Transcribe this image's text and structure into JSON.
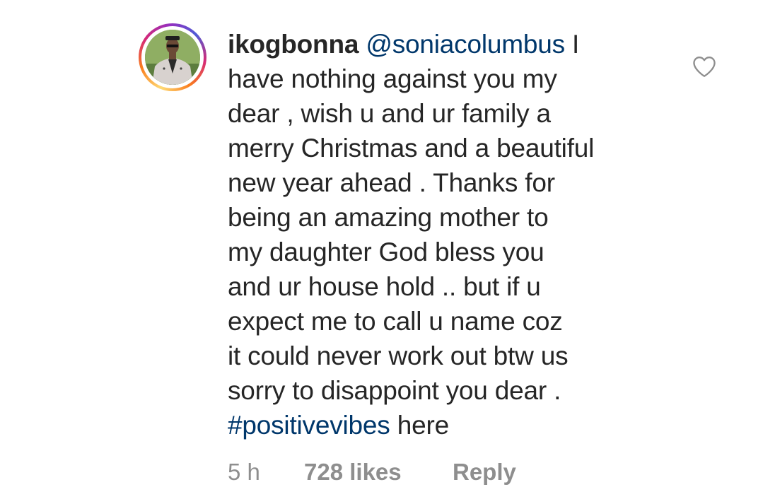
{
  "comment": {
    "username": "ikogbonna",
    "mention": "@soniacolumbus",
    "lines": [
      " I",
      "have nothing against you my",
      "dear , wish u and ur family a",
      "merry Christmas and a beautiful",
      "new year ahead . Thanks for",
      "being an amazing mother to",
      "my daughter God bless you",
      "and ur house hold .. but if u",
      "expect me to call u name coz",
      "it could never work out btw us",
      "sorry to disappoint you dear ."
    ],
    "hashtag": "#positivevibes",
    "trailing": " here",
    "time": "5 h",
    "likes": "728 likes",
    "reply_label": "Reply",
    "like_icon": "heart-outline-icon",
    "avatar_icon": "profile-picture",
    "colors": {
      "text": "#262626",
      "link": "#00376b",
      "meta": "#8e8e8e"
    }
  }
}
